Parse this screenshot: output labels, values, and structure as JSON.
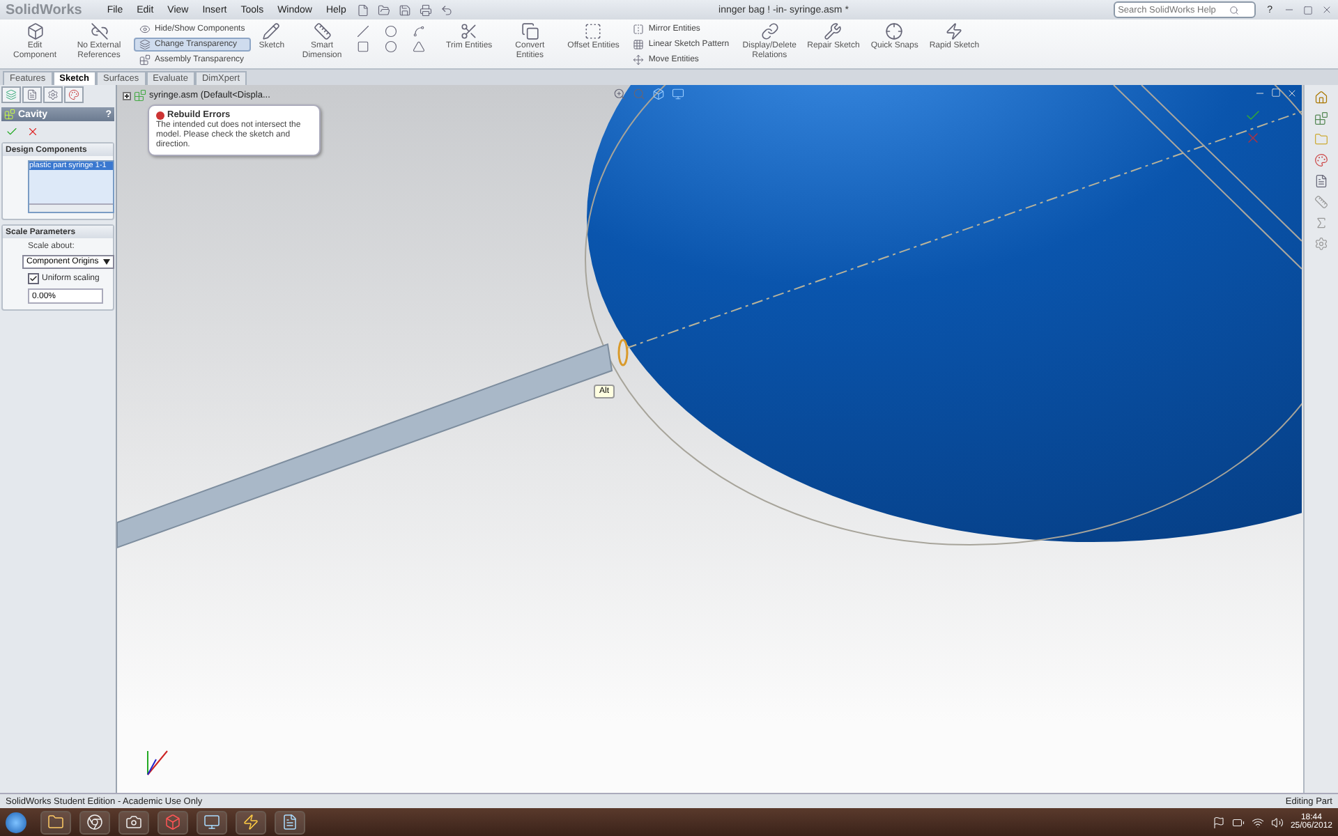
{
  "app": {
    "logo": "SolidWorks",
    "menus": [
      "File",
      "Edit",
      "View",
      "Insert",
      "Tools",
      "Window",
      "Help"
    ],
    "title": "innger bag ! -in- syringe.asm *",
    "search": {
      "placeholder": "Search SolidWorks Help"
    },
    "help": "?"
  },
  "ribbon": [
    {
      "kind": "big",
      "label": "Edit Component"
    },
    {
      "kind": "big",
      "label": "No External References"
    },
    {
      "kind": "stack",
      "entries": [
        {
          "label": "Hide/Show Components",
          "selected": false
        },
        {
          "label": "Change Transparency",
          "selected": true
        },
        {
          "label": "Assembly Transparency",
          "selected": false
        }
      ]
    },
    {
      "kind": "big",
      "label": "Sketch"
    },
    {
      "kind": "big",
      "label": "Smart Dimension"
    },
    {
      "kind": "grid"
    },
    {
      "kind": "big",
      "label": "Trim Entities"
    },
    {
      "kind": "big",
      "label": "Convert Entities"
    },
    {
      "kind": "big",
      "label": "Offset Entities"
    },
    {
      "kind": "stack",
      "entries": [
        {
          "label": "Mirror Entities",
          "selected": false
        },
        {
          "label": "Linear Sketch Pattern",
          "selected": false
        },
        {
          "label": "Move Entities",
          "selected": false
        }
      ]
    },
    {
      "kind": "big",
      "label": "Display/Delete Relations"
    },
    {
      "kind": "big",
      "label": "Repair Sketch"
    },
    {
      "kind": "big",
      "label": "Quick Snaps"
    },
    {
      "kind": "big",
      "label": "Rapid Sketch"
    }
  ],
  "tabs": [
    {
      "label": "Features",
      "selected": false
    },
    {
      "label": "Sketch",
      "selected": true
    },
    {
      "label": "Surfaces",
      "selected": false
    },
    {
      "label": "Evaluate",
      "selected": false
    },
    {
      "label": "DimXpert",
      "selected": false
    }
  ],
  "panel": {
    "title": "Cavity",
    "help": "?",
    "design_components": {
      "title": "Design Components",
      "item": "plastic part syringe 1-1"
    },
    "scale_parameters": {
      "title": "Scale Parameters",
      "label": "Scale about:",
      "dropdown": "Component Origins",
      "checkbox": {
        "label": "Uniform scaling",
        "checked": true
      },
      "value": "0.00%"
    }
  },
  "viewport": {
    "tree_item": "syringe.asm  (Default<Displa...",
    "error": {
      "title": "Rebuild Errors",
      "message": "The intended cut does not intersect the model. Please check the sketch and direction."
    },
    "hint": "Alt"
  },
  "status_bar": {
    "left": "SolidWorks Student Edition - Academic Use Only",
    "right": "Editing Part"
  },
  "taskbar": {
    "time": "18:44",
    "date": "25/06/2012"
  }
}
